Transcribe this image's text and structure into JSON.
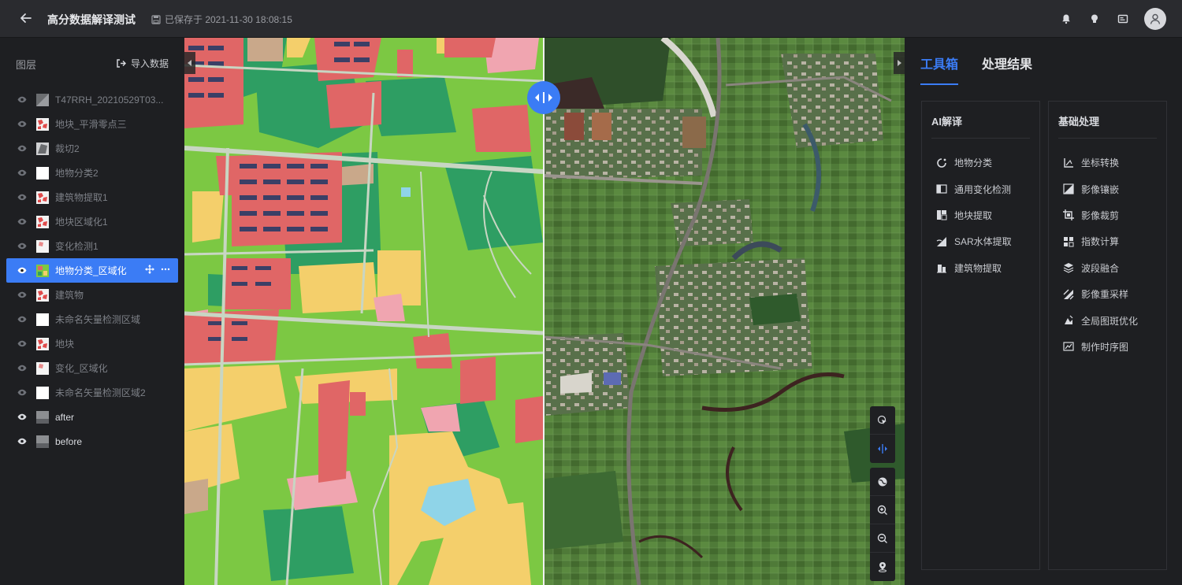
{
  "header": {
    "title": "高分数据解译测试",
    "save_status": "已保存于 2021-11-30 18:08:15"
  },
  "layers": {
    "title": "图层",
    "import_label": "导入数据",
    "items": [
      {
        "name": "T47RRH_20210529T03...",
        "visible": false,
        "thumb": "raster"
      },
      {
        "name": "地块_平滑零点三",
        "visible": false,
        "thumb": "red"
      },
      {
        "name": "裁切2",
        "visible": false,
        "thumb": "clip"
      },
      {
        "name": "地物分类2",
        "visible": false,
        "thumb": "white"
      },
      {
        "name": "建筑物提取1",
        "visible": false,
        "thumb": "red"
      },
      {
        "name": "地块区域化1",
        "visible": false,
        "thumb": "red"
      },
      {
        "name": "变化检测1",
        "visible": false,
        "thumb": "redlight"
      },
      {
        "name": "地物分类_区域化",
        "visible": true,
        "thumb": "green",
        "active": true
      },
      {
        "name": "建筑物",
        "visible": false,
        "thumb": "red"
      },
      {
        "name": "未命名矢量检测区域",
        "visible": false,
        "thumb": "white"
      },
      {
        "name": "地块",
        "visible": false,
        "thumb": "red"
      },
      {
        "name": "变化_区域化",
        "visible": false,
        "thumb": "redlight"
      },
      {
        "name": "未命名矢量检测区域2",
        "visible": false,
        "thumb": "white"
      },
      {
        "name": "after",
        "visible": true,
        "thumb": "gray"
      },
      {
        "name": "before",
        "visible": true,
        "thumb": "gray"
      }
    ]
  },
  "toolbox": {
    "tabs": [
      "工具箱",
      "处理结果"
    ],
    "active_tab": 0,
    "ai": {
      "title": "AI解译",
      "items": [
        {
          "label": "地物分类",
          "icon": "classify-icon"
        },
        {
          "label": "通用变化检测",
          "icon": "change-detect-icon"
        },
        {
          "label": "地块提取",
          "icon": "parcel-icon"
        },
        {
          "label": "SAR水体提取",
          "icon": "sar-water-icon"
        },
        {
          "label": "建筑物提取",
          "icon": "building-icon"
        }
      ]
    },
    "basic": {
      "title": "基础处理",
      "items": [
        {
          "label": "坐标转换",
          "icon": "coord-icon"
        },
        {
          "label": "影像镶嵌",
          "icon": "mosaic-icon"
        },
        {
          "label": "影像裁剪",
          "icon": "crop-icon"
        },
        {
          "label": "指数计算",
          "icon": "index-icon"
        },
        {
          "label": "波段融合",
          "icon": "band-fusion-icon"
        },
        {
          "label": "影像重采样",
          "icon": "resample-icon"
        },
        {
          "label": "全局图斑优化",
          "icon": "patch-optimize-icon"
        },
        {
          "label": "制作时序图",
          "icon": "timeseries-icon"
        }
      ]
    }
  },
  "colors": {
    "accent": "#3b7cf5",
    "green": "#7cc843",
    "dark_green": "#2e9e63",
    "red": "#e06666",
    "yellow": "#f4cf6b",
    "pink": "#f0a5b0",
    "cyan": "#8fd4e8",
    "road": "#c8d6c3",
    "building_blue": "#3b3f66",
    "tan": "#c9a88a"
  }
}
